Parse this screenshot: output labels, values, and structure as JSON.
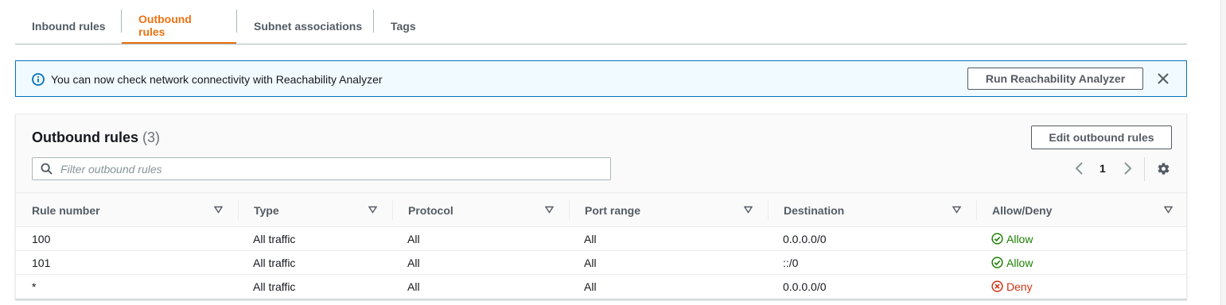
{
  "tabs": [
    {
      "label": "Inbound rules"
    },
    {
      "label": "Outbound rules"
    },
    {
      "label": "Subnet associations"
    },
    {
      "label": "Tags"
    }
  ],
  "active_tab": "Outbound rules",
  "banner": {
    "message": "You can now check network connectivity with Reachability Analyzer",
    "button_label": "Run Reachability Analyzer"
  },
  "panel": {
    "title": "Outbound rules",
    "count": "(3)",
    "edit_button_label": "Edit outbound rules",
    "filter_placeholder": "Filter outbound rules",
    "page": "1"
  },
  "table": {
    "columns": [
      "Rule number",
      "Type",
      "Protocol",
      "Port range",
      "Destination",
      "Allow/Deny"
    ],
    "rows": [
      {
        "rule_number": "100",
        "type": "All traffic",
        "protocol": "All",
        "port_range": "All",
        "destination": "0.0.0.0/0",
        "action": "Allow"
      },
      {
        "rule_number": "101",
        "type": "All traffic",
        "protocol": "All",
        "port_range": "All",
        "destination": "::/0",
        "action": "Allow"
      },
      {
        "rule_number": "*",
        "type": "All traffic",
        "protocol": "All",
        "port_range": "All",
        "destination": "0.0.0.0/0",
        "action": "Deny"
      }
    ]
  },
  "icons": {
    "info": "info-circle-icon",
    "close": "close-icon",
    "search": "search-icon",
    "prev": "chevron-left-icon",
    "next": "chevron-right-icon",
    "settings": "gear-icon",
    "sort": "sort-caret-down-icon",
    "allow": "check-circle-icon",
    "deny": "x-circle-icon"
  },
  "colors": {
    "active_tab": "#ec7211",
    "info_border": "#0073bb",
    "info_background": "#f1faff",
    "allow": "#1d8102",
    "deny": "#d13212"
  }
}
